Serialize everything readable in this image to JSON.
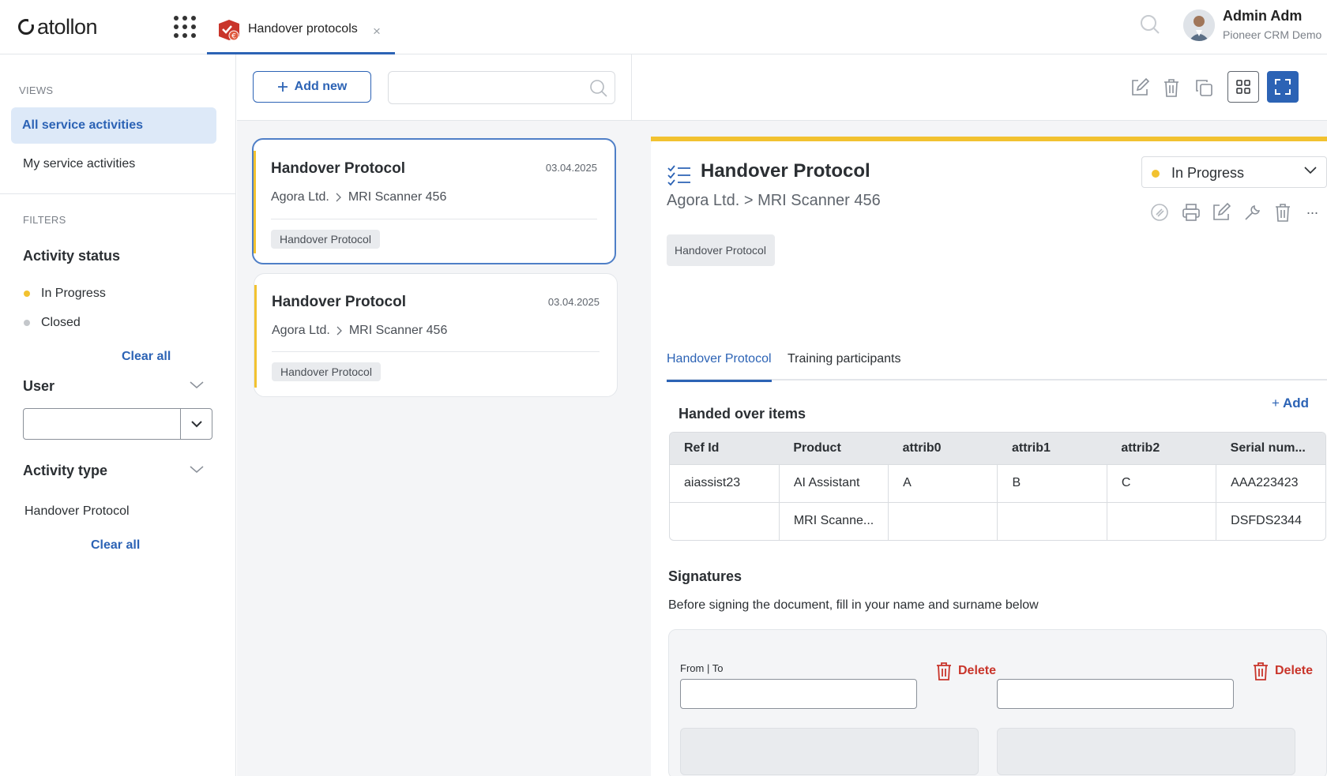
{
  "app": {
    "logo_text": "atollon",
    "tab_label": "Handover protocols",
    "tab_close": "×"
  },
  "user": {
    "name": "Admin Adm",
    "org": "Pioneer CRM Demo"
  },
  "sidebar": {
    "views_heading": "VIEWS",
    "views": [
      "All service activities",
      "My service activities"
    ],
    "filters_heading": "FILTERS",
    "activity_status": {
      "title": "Activity status",
      "items": [
        {
          "label": "In Progress",
          "color": "#f2c230"
        },
        {
          "label": "Closed",
          "color": "#c4c7cb"
        }
      ],
      "clear": "Clear all"
    },
    "user_filter": {
      "title": "User",
      "value": ""
    },
    "activity_type": {
      "title": "Activity type",
      "items": [
        "Handover Protocol"
      ],
      "clear": "Clear all"
    }
  },
  "list": {
    "add_label": "Add new",
    "search_placeholder": "",
    "cards": [
      {
        "title": "Handover Protocol",
        "date": "03.04.2025",
        "company": "Agora Ltd.",
        "object": "MRI Scanner 456",
        "tag": "Handover Protocol"
      },
      {
        "title": "Handover Protocol",
        "date": "03.04.2025",
        "company": "Agora Ltd.",
        "object": "MRI Scanner 456",
        "tag": "Handover Protocol"
      }
    ]
  },
  "detail": {
    "title": "Handover Protocol",
    "path": "Agora Ltd. > MRI Scanner 456",
    "tag": "Handover Protocol",
    "status": "In Progress",
    "more": "...",
    "tabs": [
      "Handover Protocol",
      "Training participants"
    ],
    "items_heading": "Handed over items",
    "add_label": "Add",
    "table": {
      "headers": [
        "Ref Id",
        "Product",
        "attrib0",
        "attrib1",
        "attrib2",
        "Serial num..."
      ],
      "rows": [
        [
          "aiassist23",
          "AI Assistant",
          "A",
          "B",
          "C",
          "AAA223423"
        ],
        [
          "",
          "MRI Scanne...",
          "",
          "",
          "",
          "DSFDS2344"
        ]
      ]
    },
    "signatures_heading": "Signatures",
    "signatures_hint": "Before signing the document, fill in your name and surname below",
    "from_to_label": "From | To",
    "delete_label": "Delete"
  },
  "colors": {
    "accent": "#2c63b5",
    "status_in_progress": "#f2c230",
    "status_closed": "#c4c7cb",
    "danger": "#c9352b"
  }
}
